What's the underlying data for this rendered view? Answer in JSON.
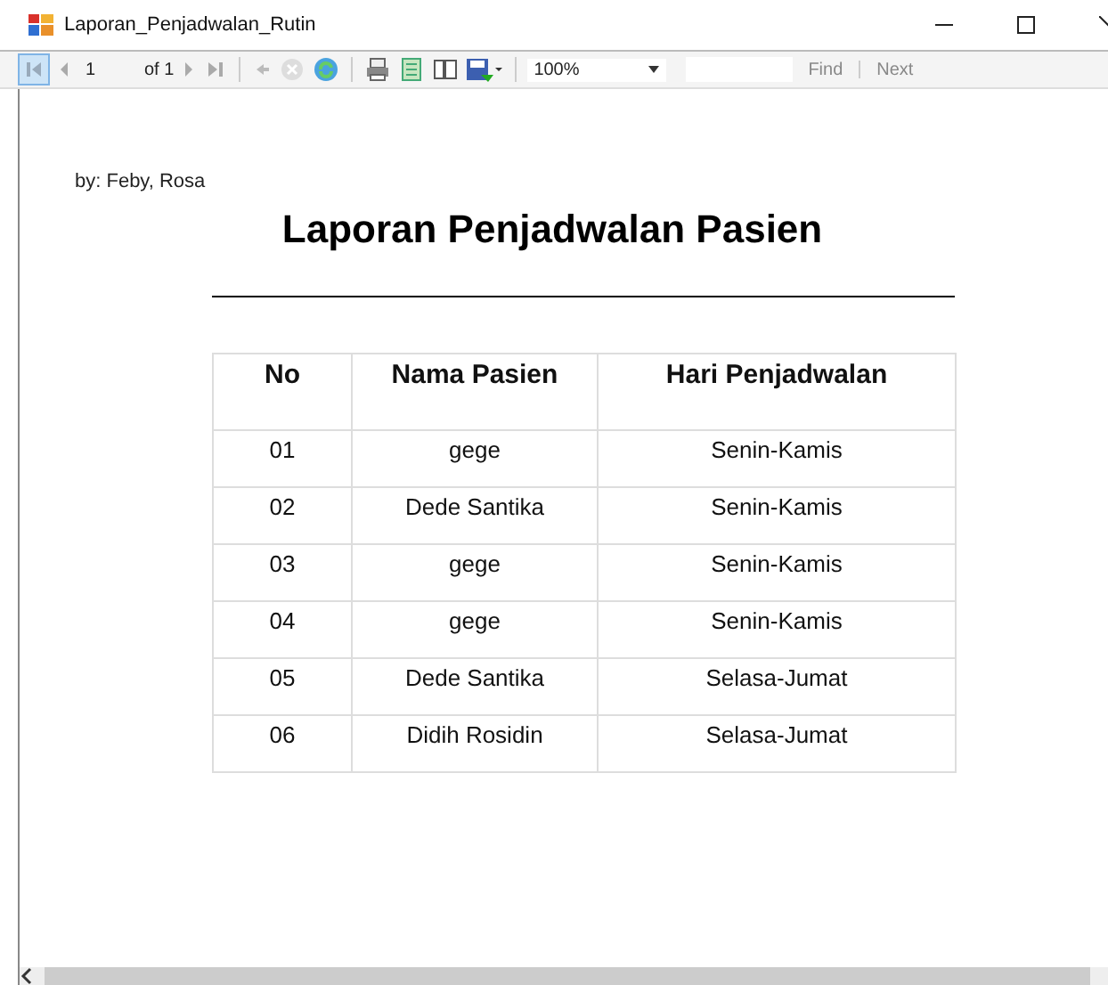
{
  "window": {
    "title": "Laporan_Penjadwalan_Rutin"
  },
  "toolbar": {
    "page": "1",
    "of_label": "of 1",
    "zoom": "100%",
    "find": "Find",
    "next": "Next"
  },
  "report": {
    "author": "by: Feby, Rosa",
    "title": "Laporan Penjadwalan Pasien",
    "columns": [
      "No",
      "Nama Pasien",
      "Hari Penjadwalan"
    ],
    "rows": [
      [
        "01",
        "gege",
        "Senin-Kamis"
      ],
      [
        "02",
        "Dede Santika",
        "Senin-Kamis"
      ],
      [
        "03",
        "gege",
        "Senin-Kamis"
      ],
      [
        "04",
        "gege",
        "Senin-Kamis"
      ],
      [
        "05",
        "Dede Santika",
        "Selasa-Jumat"
      ],
      [
        "06",
        "Didih Rosidin",
        "Selasa-Jumat"
      ]
    ]
  }
}
